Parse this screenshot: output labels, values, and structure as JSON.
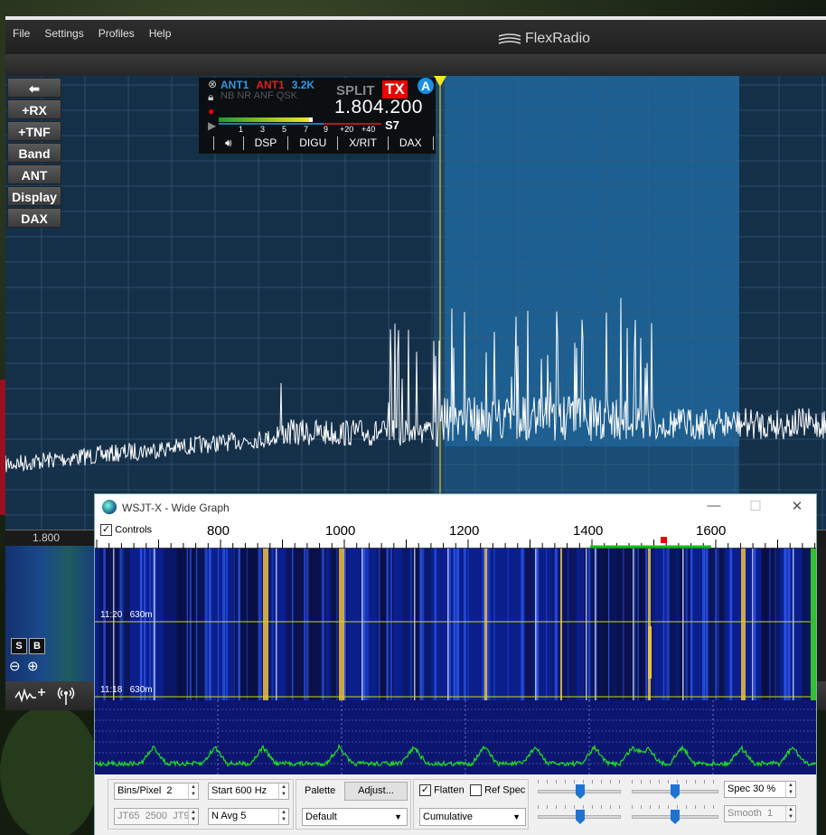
{
  "flexradio": {
    "menu": [
      "File",
      "Settings",
      "Profiles",
      "Help"
    ],
    "logo_text": "FlexRadio",
    "side_buttons": [
      "+RX",
      "+TNF",
      "Band",
      "ANT",
      "Display",
      "DAX"
    ],
    "slice": {
      "rx_ant": "ANT1",
      "tx_ant": "ANT1",
      "filter": "3.2K",
      "dsp_flags": "NB NR ANF QSK",
      "split_label": "SPLIT",
      "tx_label": "TX",
      "slice_letter": "A",
      "frequency": "1.804.200",
      "s_meter": "S7",
      "s_scale": [
        "1",
        "3",
        "5",
        "7",
        "9",
        "+20",
        "+40"
      ],
      "tabs": [
        "DSP",
        "DIGU",
        "X/RIT",
        "DAX"
      ]
    },
    "freq_label": "1.800",
    "wf_buttons": [
      "S",
      "B"
    ]
  },
  "wide_graph": {
    "title": "WSJT-X - Wide Graph",
    "controls_label": "Controls",
    "controls_checked": true,
    "scale_labels": [
      "800",
      "1000",
      "1200",
      "1400",
      "1600"
    ],
    "time_labels": [
      "11:20   630m",
      "11:18   630m"
    ],
    "bins_per_pixel": "Bins/Pixel  2",
    "start": "Start 600 Hz",
    "jt65": "JT65  2500  JT9",
    "navg": "N Avg 5",
    "palette_label": "Palette",
    "adjust_label": "Adjust...",
    "palette_value": "Default",
    "flatten_label": "Flatten",
    "flatten_checked": true,
    "ref_spec_label": "Ref Spec",
    "ref_spec_checked": false,
    "spectrum_mode": "Cumulative",
    "spec_pct": "Spec 30 %",
    "smooth": "Smooth  1"
  },
  "colors": {
    "accent_blue": "#1a8fe0",
    "tx_red": "#e00000",
    "spectrum_green": "#20e020",
    "panadapter_bg": "#16304a"
  }
}
